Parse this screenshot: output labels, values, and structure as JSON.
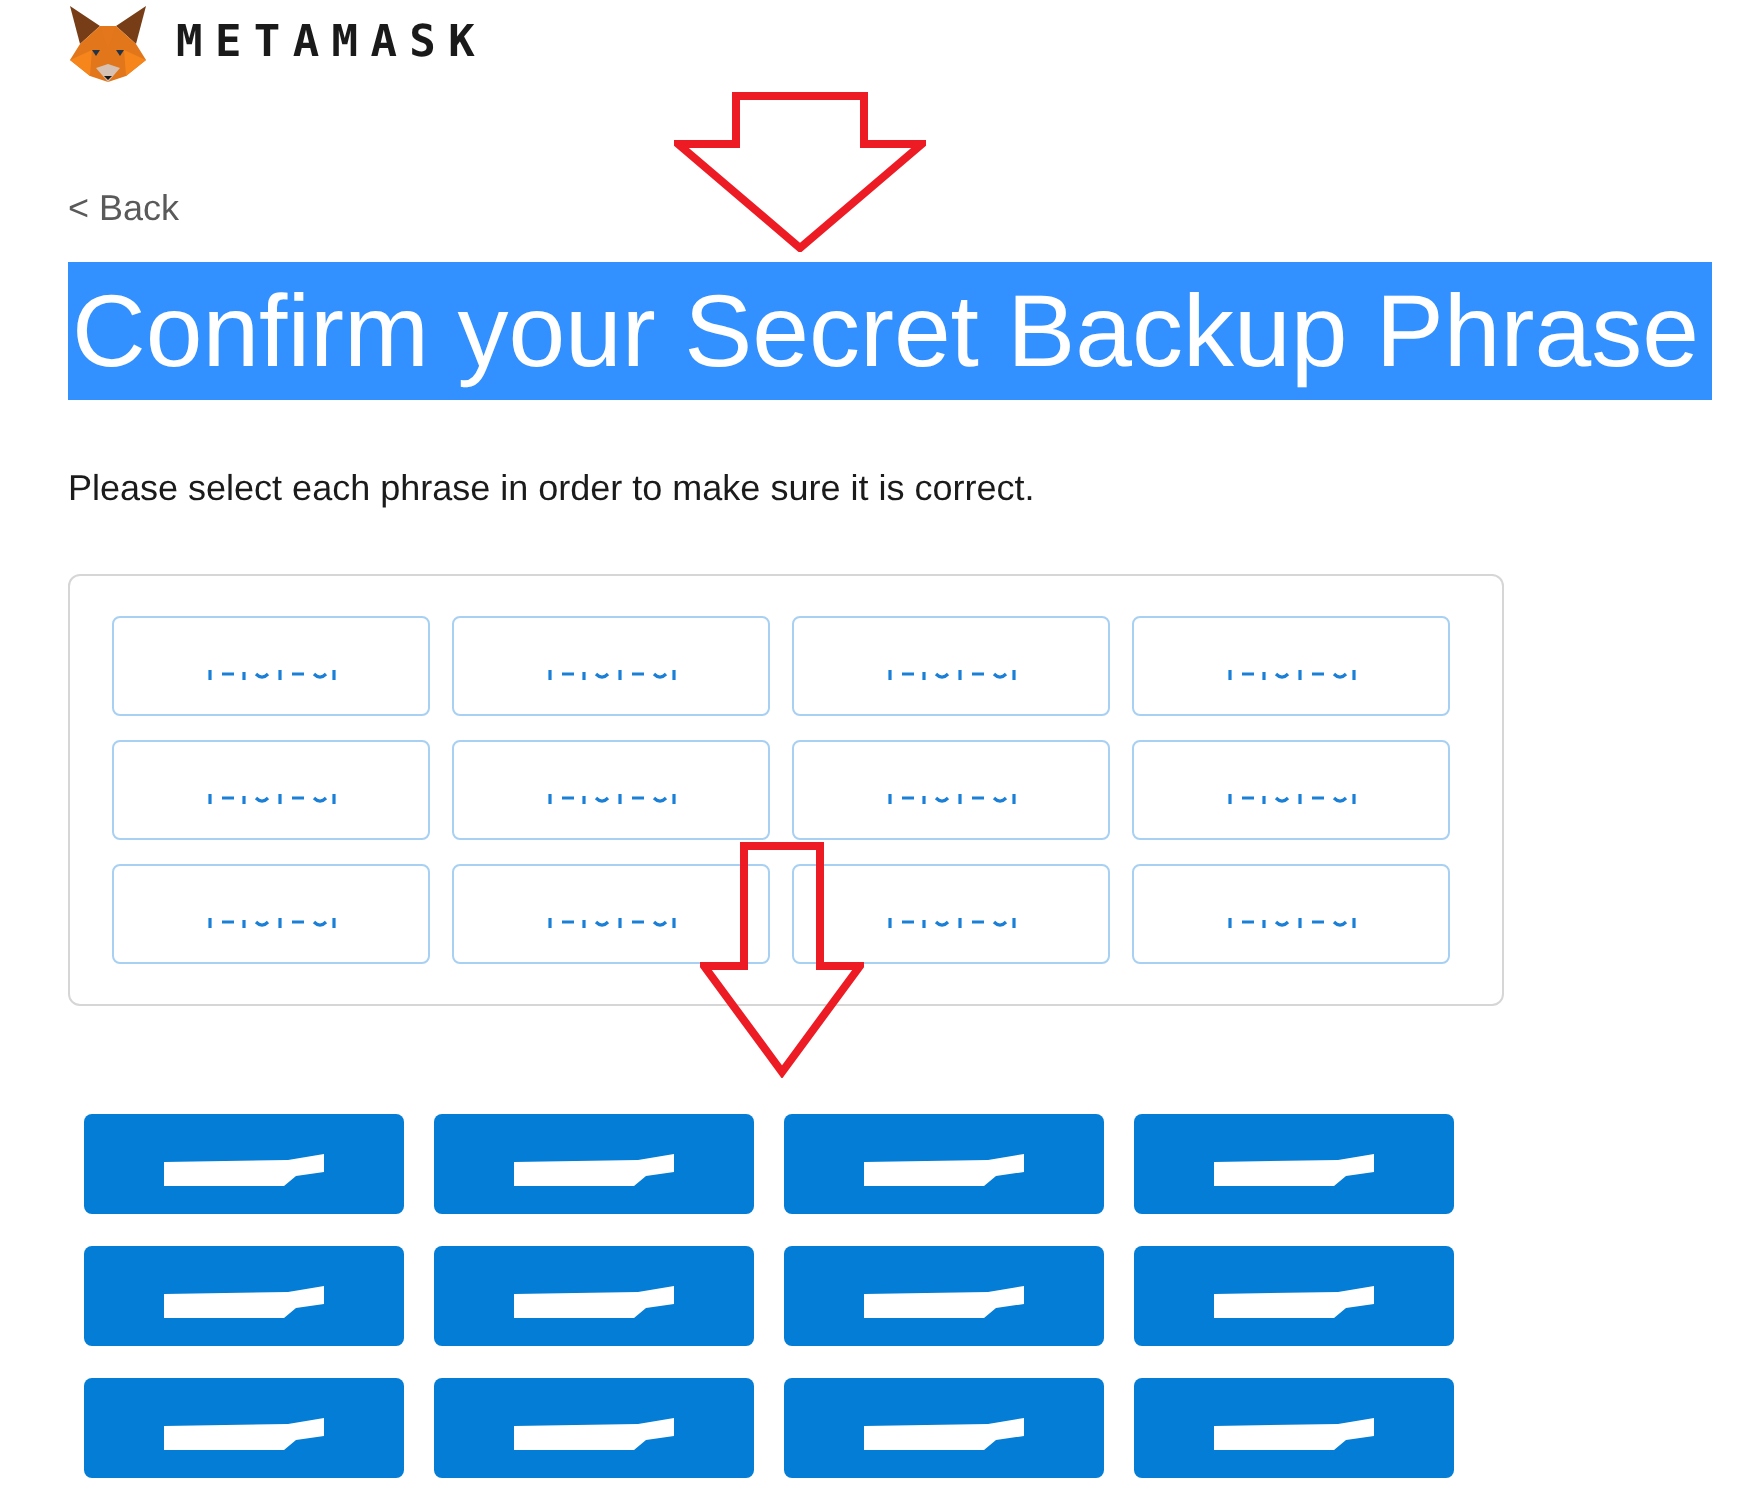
{
  "header": {
    "brand": "METAMASK"
  },
  "back_link": {
    "label": "< Back"
  },
  "title": {
    "text": "Confirm your Secret Backup Phrase",
    "highlighted": true
  },
  "instructions": "Please select each phrase in order to make sure it is correct.",
  "selected_words": [
    {
      "redacted": true
    },
    {
      "redacted": true
    },
    {
      "redacted": true
    },
    {
      "redacted": true
    },
    {
      "redacted": true
    },
    {
      "redacted": true
    },
    {
      "redacted": true
    },
    {
      "redacted": true
    },
    {
      "redacted": true
    },
    {
      "redacted": true
    },
    {
      "redacted": true
    },
    {
      "redacted": true
    }
  ],
  "word_choices": [
    {
      "redacted": true
    },
    {
      "redacted": true
    },
    {
      "redacted": true
    },
    {
      "redacted": true
    },
    {
      "redacted": true
    },
    {
      "redacted": true
    },
    {
      "redacted": true
    },
    {
      "redacted": true
    },
    {
      "redacted": true
    },
    {
      "redacted": true
    },
    {
      "redacted": true
    },
    {
      "redacted": true
    }
  ],
  "annotations": [
    {
      "kind": "down_arrow"
    },
    {
      "kind": "down_arrow"
    }
  ]
}
